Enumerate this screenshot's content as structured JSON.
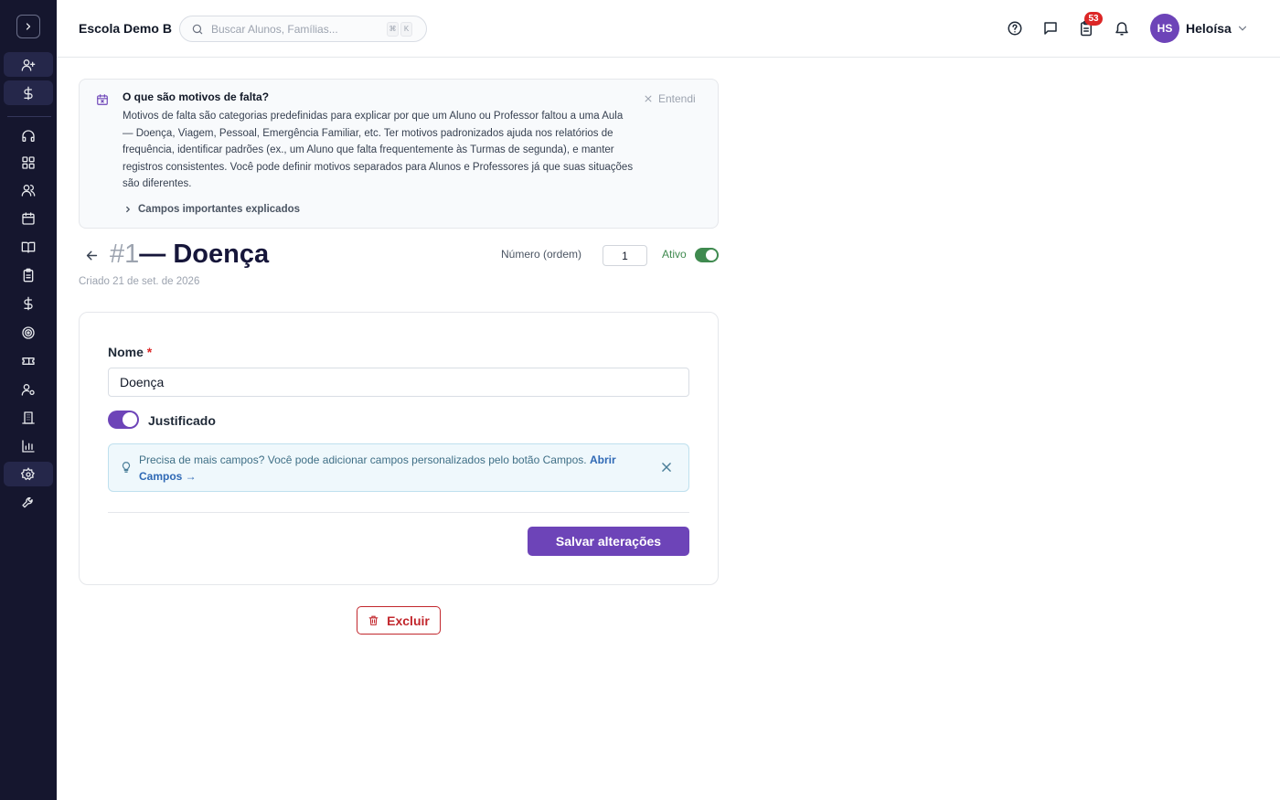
{
  "header": {
    "school_name": "Escola Demo B",
    "search_placeholder": "Buscar Alunos, Famílias...",
    "search_shortcut": [
      "⌘",
      "K"
    ],
    "notification_count": "53",
    "user_initials": "HS",
    "user_name": "Heloísa"
  },
  "info_banner": {
    "title": "O que são motivos de falta?",
    "body": "Motivos de falta são categorias predefinidas para explicar por que um Aluno ou Professor faltou a uma Aula — Doença, Viagem, Pessoal, Emergência Familiar, etc. Ter motivos padronizados ajuda nos relatórios de frequência, identificar padrões (ex., um Aluno que falta frequentemente às Turmas de segunda), e manter registros consistentes. Você pode definir motivos separados para Alunos e Professores já que suas situações são diferentes.",
    "dismiss_label": "Entendi",
    "fields_link": "Campos importantes explicados"
  },
  "record": {
    "number": "#1",
    "title": "— Doença",
    "created": "Criado 21 de set. de 2026",
    "order_label": "Número (ordem)",
    "order_value": "1",
    "active_label": "Ativo",
    "active": true
  },
  "form": {
    "name_label": "Nome",
    "required_mark": "*",
    "name_value": "Doença",
    "justified_label": "Justificado",
    "justified": true,
    "tip_text": "Precisa de mais campos? Você pode adicionar campos personalizados pelo botão Campos.",
    "tip_link": "Abrir Campos →",
    "save_label": "Salvar alterações"
  },
  "delete_label": "Excluir",
  "colors": {
    "sidebar_bg": "#15162e",
    "accent": "#6d44b8",
    "active_green": "#3f8a4f",
    "danger": "#c2272d",
    "badge": "#dc2626"
  },
  "sidebar_icons": [
    "chevron-right-icon",
    "user-plus-icon",
    "dollar-icon",
    "headset-icon",
    "dashboard-icon",
    "users-icon",
    "calendar-icon",
    "book-icon",
    "clipboard-icon",
    "dollar-icon",
    "target-icon",
    "ticket-icon",
    "user-settings-icon",
    "building-icon",
    "chart-icon",
    "gear-icon",
    "wrench-icon"
  ]
}
